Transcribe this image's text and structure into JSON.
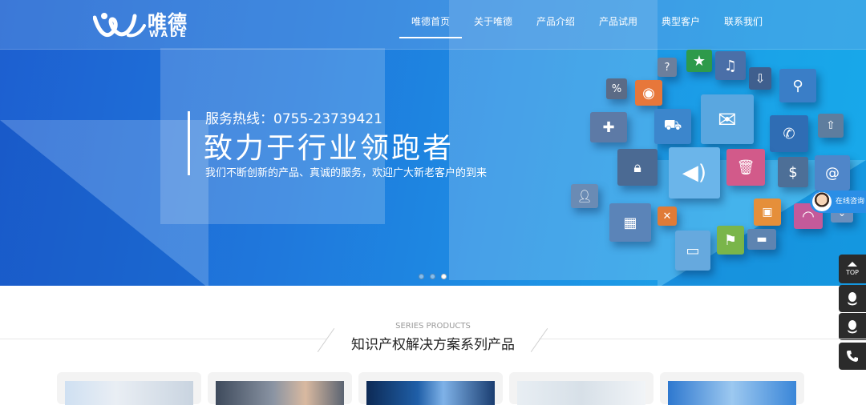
{
  "logo": {
    "cn": "唯德",
    "en": "WADE"
  },
  "nav": {
    "items": [
      {
        "label": "唯德首页",
        "active": true
      },
      {
        "label": "关于唯德",
        "active": false
      },
      {
        "label": "产品介绍",
        "active": false
      },
      {
        "label": "产品试用",
        "active": false
      },
      {
        "label": "典型客户",
        "active": false
      },
      {
        "label": "联系我们",
        "active": false
      }
    ]
  },
  "banner": {
    "hotline": "服务热线：0755-23739421",
    "headline": "致力于行业领跑者",
    "subline": "我们不断创新的产品、真诚的服务，欢迎广大新老客户的到来",
    "slides": 3,
    "active_slide": 3
  },
  "side": {
    "consult_label": "在线咨询",
    "top_label": "TOP",
    "icons": [
      "qq-icon",
      "qq-icon",
      "phone-icon"
    ]
  },
  "section": {
    "en_title": "SERIES PRODUCTS",
    "cn_title": "知识产权解决方案系列产品"
  },
  "colors": {
    "banner_start": "#1d5fd0",
    "banner_end": "#17a9ea",
    "side_dark": "#2b2b2b",
    "consult_blue": "#2a8ee6"
  }
}
